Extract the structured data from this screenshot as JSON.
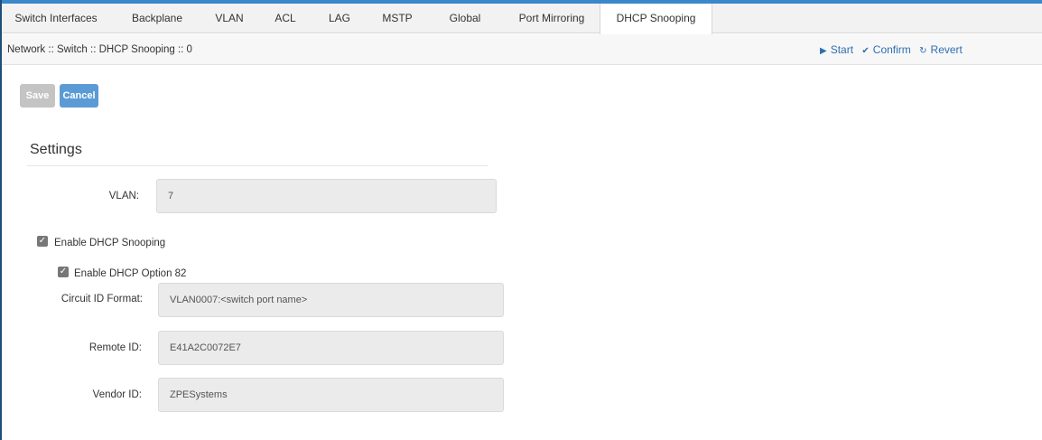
{
  "tabs": [
    {
      "label": "Switch Interfaces"
    },
    {
      "label": "Backplane"
    },
    {
      "label": "VLAN"
    },
    {
      "label": "ACL"
    },
    {
      "label": "LAG"
    },
    {
      "label": "MSTP"
    },
    {
      "label": "Global"
    },
    {
      "label": "Port Mirroring"
    },
    {
      "label": "DHCP Snooping"
    }
  ],
  "active_tab": "DHCP Snooping",
  "breadcrumb": "Network :: Switch :: DHCP Snooping :: 0",
  "actions": {
    "start": "Start",
    "confirm": "Confirm",
    "revert": "Revert"
  },
  "buttons": {
    "save": "Save",
    "cancel": "Cancel"
  },
  "settings": {
    "title": "Settings",
    "vlan_label": "VLAN:",
    "vlan_value": "7",
    "enable_snooping_label": "Enable DHCP Snooping",
    "enable_snooping_checked": true,
    "enable_option82_label": "Enable DHCP Option 82",
    "enable_option82_checked": true,
    "circuit_id_label": "Circuit ID Format:",
    "circuit_id_value": "VLAN0007:<switch port name>",
    "remote_id_label": "Remote ID:",
    "remote_id_value": "E41A2C0072E7",
    "vendor_id_label": "Vendor ID:",
    "vendor_id_value": "ZPESystems"
  },
  "colors": {
    "accent": "#5b9bd5",
    "link": "#2f6fb0",
    "top_border": "#3a88c9"
  }
}
